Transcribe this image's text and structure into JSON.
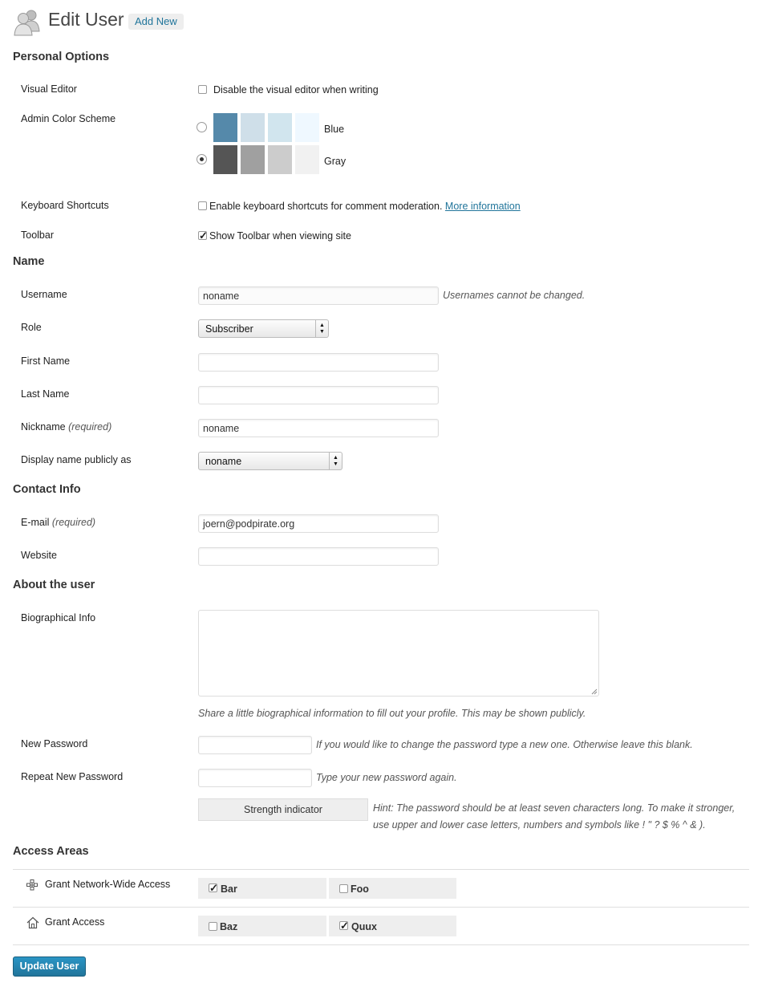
{
  "header": {
    "title": "Edit User",
    "add_new": "Add New"
  },
  "personal_options": {
    "heading": "Personal Options",
    "visual_editor": {
      "label": "Visual Editor",
      "checkbox_label": "Disable the visual editor when writing",
      "checked": false
    },
    "color_scheme": {
      "label": "Admin Color Scheme",
      "schemes": [
        {
          "name": "Blue",
          "selected": false,
          "colors": [
            "#5589aa",
            "#cfdfe9",
            "#d1e5ee",
            "#eff8ff"
          ]
        },
        {
          "name": "Gray",
          "selected": true,
          "colors": [
            "#555555",
            "#a0a0a0",
            "#cccccc",
            "#f1f1f1"
          ]
        }
      ]
    },
    "keyboard_shortcuts": {
      "label": "Keyboard Shortcuts",
      "checkbox_label": "Enable keyboard shortcuts for comment moderation.",
      "link": "More information",
      "checked": false
    },
    "toolbar": {
      "label": "Toolbar",
      "checkbox_label": "Show Toolbar when viewing site",
      "checked": true
    }
  },
  "name": {
    "heading": "Name",
    "username": {
      "label": "Username",
      "value": "noname",
      "description": "Usernames cannot be changed."
    },
    "role": {
      "label": "Role",
      "value": "Subscriber"
    },
    "first_name": {
      "label": "First Name",
      "value": ""
    },
    "last_name": {
      "label": "Last Name",
      "value": ""
    },
    "nickname": {
      "label": "Nickname",
      "required": "(required)",
      "value": "noname"
    },
    "display_name": {
      "label": "Display name publicly as",
      "value": "noname"
    }
  },
  "contact": {
    "heading": "Contact Info",
    "email": {
      "label": "E-mail",
      "required": "(required)",
      "value": "joern@podpirate.org"
    },
    "website": {
      "label": "Website",
      "value": ""
    }
  },
  "about": {
    "heading": "About the user",
    "bio": {
      "label": "Biographical Info",
      "value": "",
      "description": "Share a little biographical information to fill out your profile. This may be shown publicly."
    },
    "new_password": {
      "label": "New Password",
      "description": "If you would like to change the password type a new one. Otherwise leave this blank."
    },
    "repeat_password": {
      "label": "Repeat New Password",
      "description": "Type your new password again."
    },
    "strength": {
      "label": "Strength indicator",
      "hint_line1": "Hint: The password should be at least seven characters long. To make it stronger,",
      "hint_line2": "use upper and lower case letters, numbers and symbols like ! \" ? $ % ^ & )."
    }
  },
  "access": {
    "heading": "Access Areas",
    "rows": [
      {
        "label": "Grant Network-Wide Access",
        "icon": "network-icon",
        "items": [
          {
            "name": "Bar",
            "checked": true
          },
          {
            "name": "Foo",
            "checked": false
          }
        ]
      },
      {
        "label": "Grant Access",
        "icon": "home-icon",
        "items": [
          {
            "name": "Baz",
            "checked": false
          },
          {
            "name": "Quux",
            "checked": true
          }
        ]
      }
    ]
  },
  "submit": {
    "label": "Update User"
  },
  "colors": {
    "link": "#21759b",
    "primary_button": "#21759b"
  }
}
